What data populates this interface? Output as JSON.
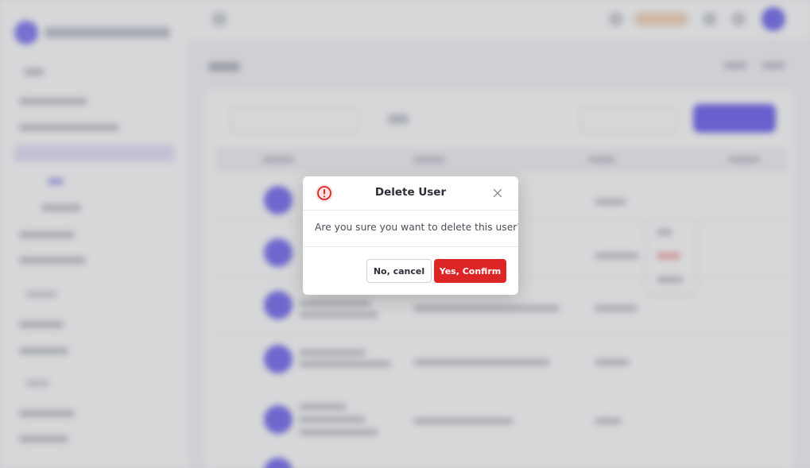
{
  "background": {
    "description_hidden": true
  },
  "dialog": {
    "title": "Delete User",
    "message": "Are you sure you want to delete this user?",
    "cancel_label": "No, cancel",
    "confirm_label": "Yes, Confirm",
    "warning_icon": "exclamation-circle-icon",
    "close_icon": "close-icon",
    "colors": {
      "danger": "#dc2626",
      "accent": "#7a70f2"
    }
  }
}
